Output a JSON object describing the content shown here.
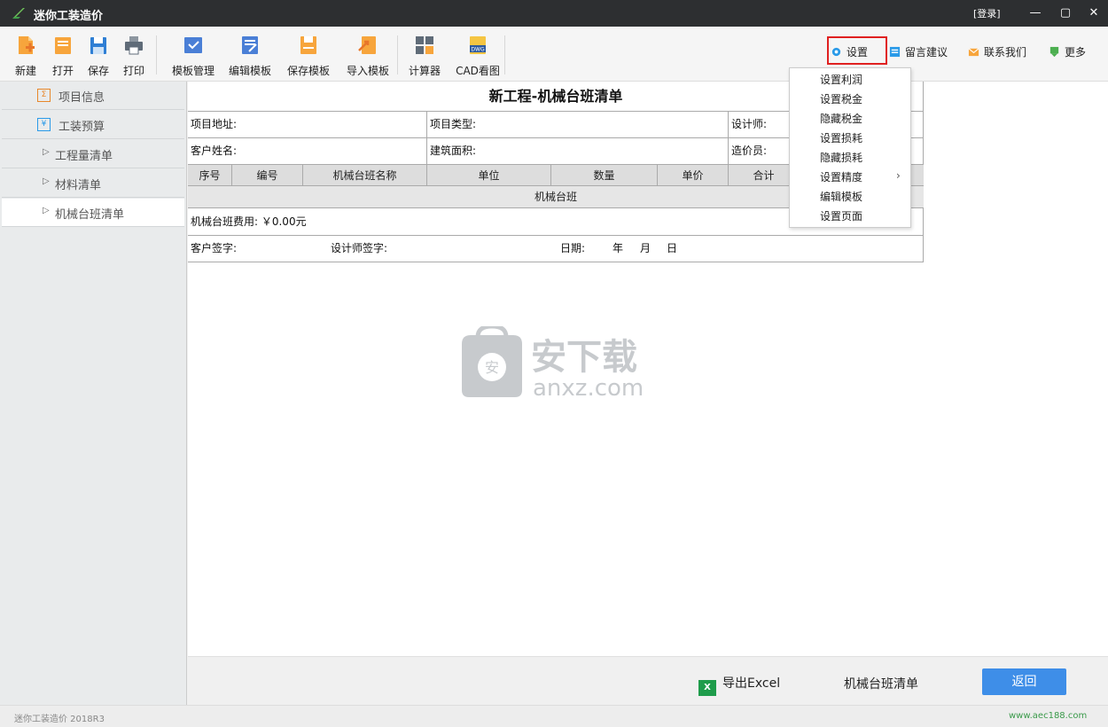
{
  "window": {
    "title": "迷你工装造价",
    "login_label": "[登录]",
    "minimize": "—",
    "maximize": "▢",
    "close": "✕"
  },
  "toolbar": {
    "left_buttons": [
      {
        "label": "新建",
        "icon": "new-file-icon"
      },
      {
        "label": "打开",
        "icon": "open-folder-icon"
      },
      {
        "label": "保存",
        "icon": "save-icon"
      },
      {
        "label": "打印",
        "icon": "print-icon"
      },
      {
        "label": "模板管理",
        "icon": "template-manage-icon"
      },
      {
        "label": "编辑模板",
        "icon": "edit-template-icon"
      },
      {
        "label": "保存模板",
        "icon": "save-template-icon"
      },
      {
        "label": "导入模板",
        "icon": "import-template-icon"
      },
      {
        "label": "计算器",
        "icon": "calculator-icon"
      },
      {
        "label": "CAD看图",
        "icon": "dwg-icon"
      }
    ],
    "dwg_badge": "DWG",
    "right_buttons": [
      {
        "label": "设置",
        "icon": "gear-icon"
      },
      {
        "label": "留言建议",
        "icon": "message-icon"
      },
      {
        "label": "联系我们",
        "icon": "mail-icon"
      },
      {
        "label": "更多",
        "icon": "more-icon"
      }
    ]
  },
  "sidebar": {
    "items": [
      {
        "label": "项目信息",
        "icon_glyph": "Σ",
        "icon_color": "#e8872a"
      },
      {
        "label": "工装预算",
        "icon_glyph": "¥",
        "icon_color": "#2a9ae8"
      },
      {
        "label": "工程量清单"
      },
      {
        "label": "材料清单"
      },
      {
        "label": "机械台班清单",
        "active": true
      }
    ]
  },
  "document": {
    "title": "新工程-机械台班清单",
    "info_rows": [
      {
        "c1": "项目地址:",
        "c2": "项目类型:",
        "c3": "设计师:"
      },
      {
        "c1": "客户姓名:",
        "c2": "建筑面积:",
        "c3": "造价员:"
      }
    ],
    "columns": [
      "序号",
      "编号",
      "机械台班名称",
      "单位",
      "数量",
      "单价",
      "合计"
    ],
    "section_label": "机械台班",
    "fee_line": "机械台班费用: ￥0.00元",
    "signature": {
      "customer": "客户签字:",
      "designer": "设计师签字:",
      "date": "日期:",
      "year": "年",
      "month": "月",
      "day": "日"
    }
  },
  "settings_menu": {
    "items": [
      "设置利润",
      "设置税金",
      "隐藏税金",
      "设置损耗",
      "隐藏损耗",
      "设置精度",
      "编辑模板",
      "设置页面"
    ],
    "submenu_arrow": "›"
  },
  "watermark": {
    "line1": "安下载",
    "line2": "anxz.com",
    "badge": "安"
  },
  "bottom_bar": {
    "export_label": "导出Excel",
    "excel_badge": "X",
    "current_sheet": "机械台班清单",
    "back_label": "返回"
  },
  "status_bar": {
    "version": "迷你工装造价 2018R3",
    "website": "www.aec188.com"
  },
  "colors": {
    "titlebar": "#2d2f31",
    "accent_blue": "#3e8ee8",
    "highlight_red": "#e02020",
    "excel_green": "#1f9c4b"
  }
}
